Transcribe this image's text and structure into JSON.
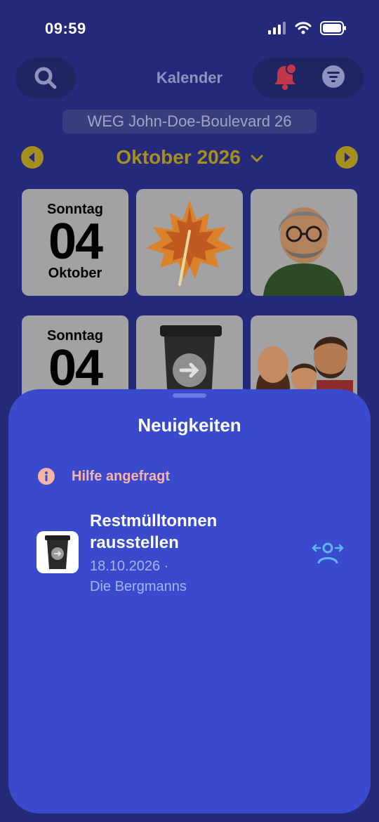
{
  "status_bar": {
    "time": "09:59"
  },
  "header": {
    "title": "Kalender",
    "icons": {
      "search": "search-icon",
      "bell": "bell-icon",
      "filter": "filter-icon"
    },
    "bell_badge_color": "#c2384b"
  },
  "address": "WEG John-Doe-Boulevard 26",
  "month_nav": {
    "label": "Oktober 2026",
    "accent_color": "#a58f21"
  },
  "calendar_rows": [
    {
      "weekday": "Sonntag",
      "day": "04",
      "month": "Oktober",
      "images": [
        "maple-leaf-image",
        "man-avatar-image"
      ]
    },
    {
      "weekday": "Sonntag",
      "day": "04",
      "images": [
        "trash-bin-image",
        "family-image"
      ]
    }
  ],
  "news_sheet": {
    "title": "Neuigkeiten",
    "section_label": "Hilfe angefragt",
    "section_color": "#f6b4a6",
    "items": [
      {
        "title": "Restmülltonnen rausstellen",
        "meta_line1": "18.10.2026 ·",
        "meta_line2": "Die Bergmanns",
        "icon": "assign-person-icon"
      }
    ]
  }
}
